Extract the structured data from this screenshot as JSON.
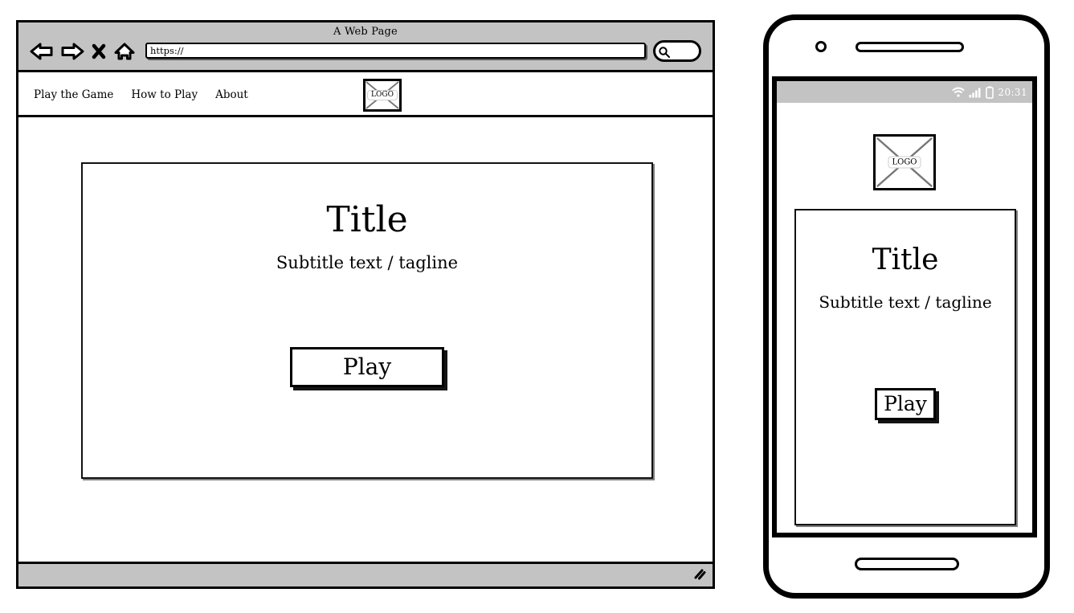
{
  "browser": {
    "window_title": "A Web Page",
    "toolbar": {
      "back_icon": "back-arrow-icon",
      "forward_icon": "forward-arrow-icon",
      "stop_icon": "stop-x-icon",
      "home_icon": "home-icon",
      "url_value": "https://",
      "url_placeholder": "https://",
      "search_icon": "search-magnifier-icon"
    },
    "site_nav": {
      "links": [
        {
          "label": "Play the Game"
        },
        {
          "label": "How to Play"
        },
        {
          "label": "About"
        }
      ],
      "logo_label": "LOGO"
    },
    "hero": {
      "title": "Title",
      "subtitle": "Subtitle text / tagline",
      "play_label": "Play"
    },
    "footer": {
      "resize_grip_icon": "resize-grip-icon"
    }
  },
  "phone": {
    "statusbar": {
      "wifi_icon": "wifi-icon",
      "signal_icon": "signal-bars-icon",
      "battery_icon": "battery-icon",
      "clock": "20:31"
    },
    "logo_label": "LOGO",
    "hero": {
      "title": "Title",
      "subtitle": "Subtitle text / tagline",
      "play_label": "Play"
    },
    "hardware": {
      "camera_icon": "front-camera-icon",
      "speaker_icon": "earpiece-speaker-icon",
      "home_button_icon": "home-button-icon"
    }
  },
  "colors": {
    "chrome_gray": "#c3c3c3",
    "ink": "#000000",
    "paper": "#ffffff"
  }
}
